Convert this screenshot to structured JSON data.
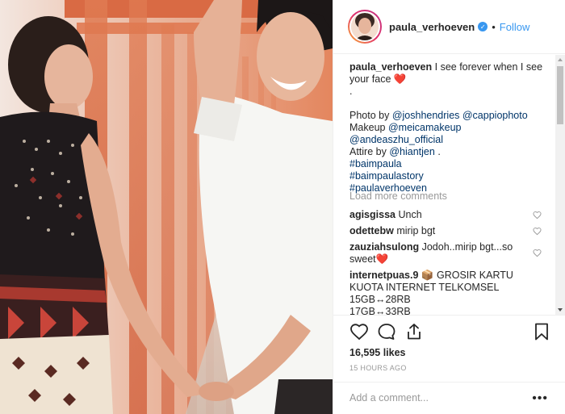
{
  "post": {
    "username": "paula_verhoeven",
    "dot": "•",
    "follow_label": "Follow",
    "verified_icon": "verified-badge-icon",
    "photo_description_icon": "couple-photo",
    "caption": {
      "username": "paula_verhoeven",
      "text": "I see forever when I see your face",
      "emoji": "❤️",
      "line_dot": ".",
      "credits": {
        "photo_prefix": "Photo by",
        "photo_handles": "@joshhendries @cappiophoto",
        "makeup_prefix": "Makeup",
        "makeup_handle": "@meicamakeup",
        "makeup_handle2": "@andeaszhu_official",
        "attire_prefix": "Attire by",
        "attire_handle": "@hiantjen",
        "attire_suffix": ".",
        "hashtag1": "#baimpaula",
        "hashtag2": "#baimpaulastory",
        "hashtag3": "#paulaverhoeven"
      }
    },
    "load_more": "Load more comments",
    "comments": [
      {
        "username": "agisgissa",
        "text": "Unch"
      },
      {
        "username": "odettebw",
        "text": "mirip bgt"
      },
      {
        "username": "zauziahsulong",
        "text": "Jodoh..mirip bgt...so sweet",
        "emoji": "❤️"
      },
      {
        "username": "internetpuas.9",
        "emoji": "📦",
        "text_line1": "GROSIR KARTU",
        "text_line2": "KUOTA INTERNET TELKOMSEL",
        "text_line3": "15GB↔28RB",
        "text_line4": "17GB↔33RB"
      }
    ],
    "likes": "16,595 likes",
    "time_ago": "15 HOURS AGO",
    "add_comment_placeholder": "Add a comment...",
    "more_options": "•••"
  },
  "colors": {
    "accent": "#3897f0",
    "text": "#262626",
    "muted": "#999999",
    "heart": "#e2242b"
  }
}
